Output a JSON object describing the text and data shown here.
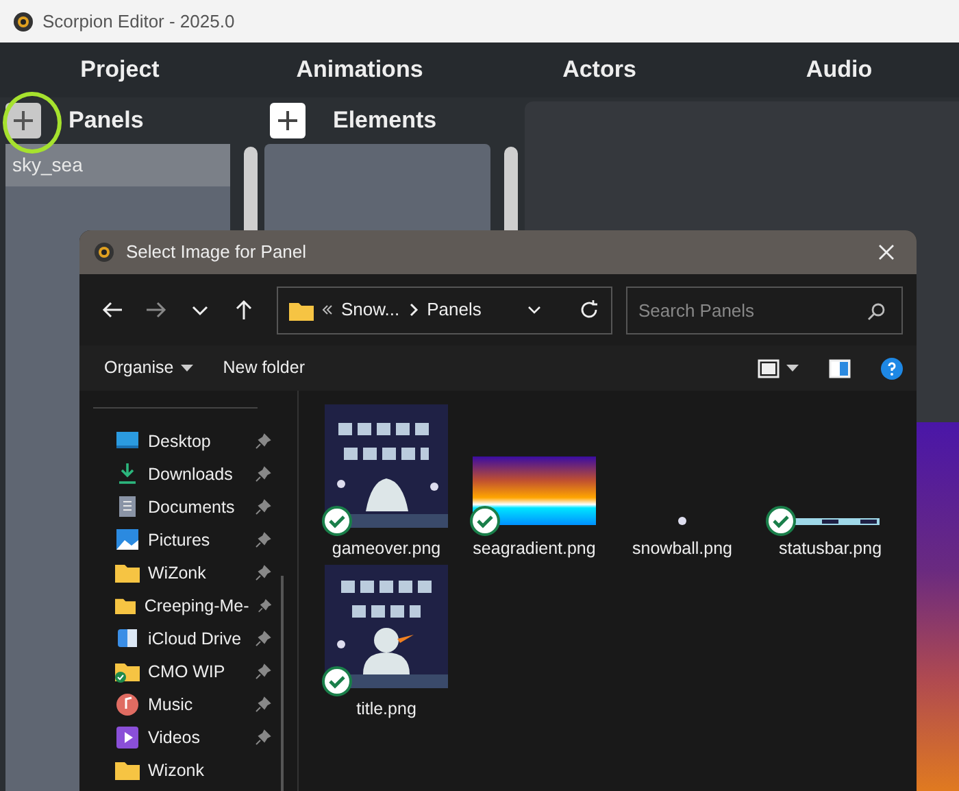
{
  "window": {
    "title": "Scorpion Editor - 2025.0"
  },
  "main_tabs": [
    {
      "label": "Project"
    },
    {
      "label": "Animations"
    },
    {
      "label": "Actors"
    },
    {
      "label": "Audio"
    }
  ],
  "panels": {
    "title": "Panels",
    "items": [
      {
        "label": "sky_sea",
        "selected": true
      }
    ]
  },
  "elements": {
    "title": "Elements"
  },
  "dialog": {
    "title": "Select Image for Panel",
    "breadcrumb": [
      {
        "label": "Snow..."
      },
      {
        "label": "Panels"
      }
    ],
    "search": {
      "placeholder": "Search Panels"
    },
    "commands": [
      {
        "label": "Organise",
        "dropdown": true
      },
      {
        "label": "New folder",
        "dropdown": false
      }
    ],
    "nav_items": [
      {
        "label": "Desktop",
        "kind": "desktop",
        "pinned": true
      },
      {
        "label": "Downloads",
        "kind": "download",
        "pinned": true
      },
      {
        "label": "Documents",
        "kind": "document",
        "pinned": true
      },
      {
        "label": "Pictures",
        "kind": "pictures",
        "pinned": true
      },
      {
        "label": "WiZonk",
        "kind": "folder",
        "pinned": true
      },
      {
        "label": "Creeping-Me-",
        "kind": "folder",
        "pinned": true
      },
      {
        "label": "iCloud Drive",
        "kind": "cloud",
        "pinned": true
      },
      {
        "label": "CMO WIP",
        "kind": "synced-folder",
        "pinned": true
      },
      {
        "label": "Music",
        "kind": "music",
        "pinned": true
      },
      {
        "label": "Videos",
        "kind": "video",
        "pinned": true
      },
      {
        "label": "Wizonk",
        "kind": "folder",
        "pinned": false
      }
    ],
    "files": [
      {
        "name": "gameover.png",
        "kind": "rock-poster",
        "synced": true
      },
      {
        "name": "seagradient.png",
        "kind": "gradient",
        "synced": true
      },
      {
        "name": "snowball.png",
        "kind": "dot",
        "synced": false
      },
      {
        "name": "statusbar.png",
        "kind": "strip",
        "synced": true
      },
      {
        "name": "title.png",
        "kind": "snowman-poster",
        "synced": true
      }
    ]
  }
}
